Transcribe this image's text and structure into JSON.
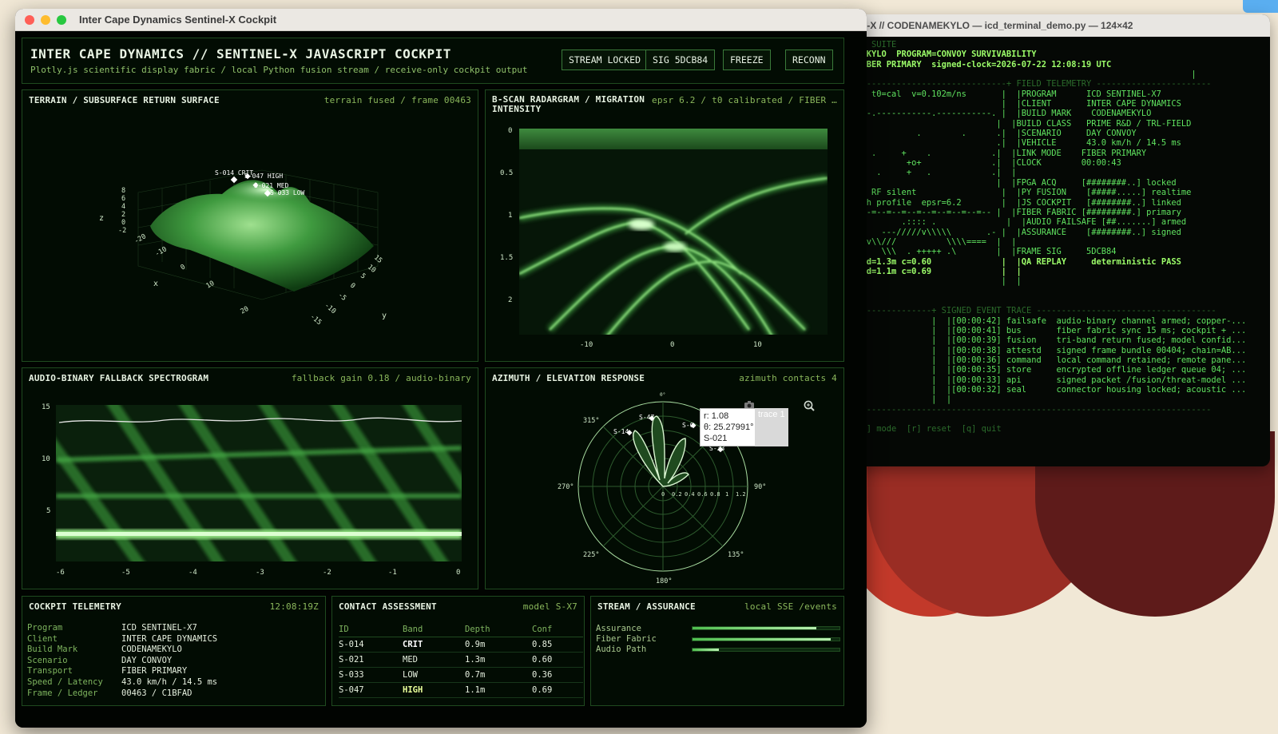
{
  "desktop": {
    "accent": "#5aaef0"
  },
  "terminal": {
    "title": "l-X // CODENAMEKYLO — icd_terminal_demo.py — 124×42",
    "lines": [
      {
        "text": "ION SUITE",
        "cls": "t-dim"
      },
      {
        "text": "AMEKYLO  PROGRAM=CONVOY SURVIVABILITY",
        "cls": "t-bright"
      },
      {
        "text": "=FIBER PRIMARY  signed-clock=2026-07-22 12:08:19 UTC",
        "cls": "t-bright"
      },
      {
        "text": "                                                                    |",
        "cls": ""
      },
      {
        "text": "-------------------------------+ FIELD TELEMETRY -----------------------",
        "cls": "t-dim"
      },
      {
        "text": "63  t0=cal  v=0.102m/ns       |  |PROGRAM      ICD SENTINEL-X7",
        "cls": ""
      },
      {
        "text": "                              |  |CLIENT       INTER CAPE DYNAMICS",
        "cls": ""
      },
      {
        "text": "----.-----------.-----------. |  |BUILD MARK    CODENAMEKYLO",
        "cls": ""
      },
      {
        "text": "                             |  |BUILD CLASS   PRIME R&D / TRL-FIELD",
        "cls": ""
      },
      {
        "text": "  .          .        .      .|  |SCENARIO     DAY CONVOY",
        "cls": ""
      },
      {
        "text": "+                            .|  |VEHICLE      43.0 km/h / 14.5 ms",
        "cls": ""
      },
      {
        "text": "x+  .     +    .            .|  |LINK MODE    FIBER PRIMARY",
        "cls": ""
      },
      {
        "text": "+          +o+              .|  |CLOCK        00:00:43",
        "cls": ""
      },
      {
        "text": "     .     +   .            .|  |",
        "cls": ""
      },
      {
        "text": "                             |  |FPGA ACQ     [########..] locked",
        "cls": ""
      },
      {
        "text": "B | RF silent                 |  |PY FUSION    [#####.....] realtime",
        "cls": ""
      },
      {
        "text": "epth profile  epsr=6.2        |  |JS COCKPIT   [########..] linked",
        "cls": ""
      },
      {
        "text": "-=--=--=--=--=--=--=--=--=-- |  |FIBER FABRIC [#########.] primary",
        "cls": ""
      },
      {
        "text": "          .:::: .              |  |AUDIO FAILSAFE [##.......] armed",
        "cls": ""
      },
      {
        "text": "      ---/////v\\\\\\\\\\       .- |  |ASSURANCE    [########..] signed",
        "cls": ""
      },
      {
        "text": "///v\\\\///          \\\\\\\\====  |  |",
        "cls": ""
      },
      {
        "text": "  /   \\\\\\  . +++++ .\\        |  |FRAME SIG     5DCB84",
        "cls": ""
      },
      {
        "text": "ED d=1.3m c=0.60              |  |QA REPLAY     deterministic PASS",
        "cls": "t-bright"
      },
      {
        "text": "GH d=1.1m c=0.69              |  |",
        "cls": "t-bright"
      },
      {
        "text": "                              |  |",
        "cls": ""
      },
      {
        "text": "",
        "cls": ""
      },
      {
        "text": "",
        "cls": ""
      },
      {
        "text": "----------------+ SIGNED EVENT TRACE ------------------------------------",
        "cls": "t-dim"
      },
      {
        "text": "                |  |[00:00:42] failsafe  audio-binary channel armed; copper-...",
        "cls": ""
      },
      {
        "text": "                |  |[00:00:41] bus       fiber fabric sync 15 ms; cockpit + ...",
        "cls": ""
      },
      {
        "text": "                |  |[00:00:39] fusion    tri-band return fused; model confid...",
        "cls": ""
      },
      {
        "text": "ore             |  |[00:00:38] attestd   signed frame bundle 00404; chain=AB...",
        "cls": ""
      },
      {
        "text": "ll              |  |[00:00:36] command   local command retained; remote pane...",
        "cls": ""
      },
      {
        "text": "                |  |[00:00:35] store     encrypted offline ledger queue 04; ...",
        "cls": ""
      },
      {
        "text": "and             |  |[00:00:33] api       signed packet /fusion/threat-model ...",
        "cls": ""
      },
      {
        "text": "                |  |[00:00:32] seal      connector housing locked; acoustic ...",
        "cls": ""
      },
      {
        "text": "                |  |",
        "cls": ""
      },
      {
        "text": "------------------------------------------------------------------------",
        "cls": "t-dim"
      },
      {
        "text": "",
        "cls": ""
      },
      {
        "text": " [m] mode  [r] reset  [q] quit",
        "cls": "t-dim"
      }
    ]
  },
  "window": {
    "title": "Inter Cape Dynamics Sentinel-X Cockpit"
  },
  "header": {
    "title": "INTER CAPE DYNAMICS // SENTINEL-X JAVASCRIPT COCKPIT",
    "subtitle": "Plotly.js scientific display fabric / local Python fusion stream / receive-only cockpit output",
    "buttons": {
      "stream": "STREAM LOCKED",
      "sig": "SIG 5DCB84",
      "freeze": "FREEZE",
      "reconn": "RECONN"
    }
  },
  "terrain": {
    "title": "TERRAIN / SUBSURFACE RETURN SURFACE",
    "meta": "terrain fused / frame 00463",
    "z_ticks": [
      "8",
      "6",
      "4",
      "2",
      "0",
      "-2"
    ],
    "x_ticks": [
      "-20",
      "-10",
      "0",
      "10",
      "20"
    ],
    "y_ticks": [
      "15",
      "10",
      "5",
      "0",
      "-5",
      "-10",
      "-15"
    ],
    "x_label": "x",
    "y_label": "y",
    "z_label": "z",
    "markers": [
      "S-014 CRIT",
      "S-047 HIGH",
      "S-021 MED",
      "S-033 LOW"
    ]
  },
  "bscan": {
    "title": "B-SCAN RADARGRAM / MIGRATION INTENSITY",
    "meta": "epsr 6.2 / t0 calibrated / FIBER …",
    "y_ticks": [
      "0",
      "0.5",
      "1",
      "1.5",
      "2"
    ],
    "x_ticks": [
      "-10",
      "0",
      "10"
    ]
  },
  "spectrogram": {
    "title": "AUDIO-BINARY FALLBACK SPECTROGRAM",
    "meta": "fallback gain 0.18 / audio-binary",
    "y_ticks": [
      "15",
      "10",
      "5"
    ],
    "x_ticks": [
      "-6",
      "-5",
      "-4",
      "-3",
      "-2",
      "-1",
      "0"
    ]
  },
  "polar": {
    "title": "AZIMUTH / ELEVATION RESPONSE",
    "meta": "azimuth contacts 4",
    "angle_labels": [
      "0°",
      "315°",
      "270°",
      "225°",
      "180°",
      "135°",
      "90°"
    ],
    "radial_ticks": [
      "0",
      "0.2",
      "0.4",
      "0.6",
      "0.8",
      "1",
      "1.2"
    ],
    "contacts": [
      "S-47",
      "S-14",
      "S-0",
      "S-33"
    ],
    "tooltip": {
      "r": "r: 1.08",
      "theta": "θ: 25.27991°",
      "name": "S-021"
    },
    "trace_tag": "trace 1"
  },
  "telemetry": {
    "title": "COCKPIT TELEMETRY",
    "time": "12:08:19Z",
    "rows": [
      {
        "k": "Program",
        "v": "ICD SENTINEL-X7"
      },
      {
        "k": "Client",
        "v": "INTER CAPE DYNAMICS"
      },
      {
        "k": "Build Mark",
        "v": "CODENAMEKYLO"
      },
      {
        "k": "Scenario",
        "v": "DAY CONVOY"
      },
      {
        "k": "Transport",
        "v": "FIBER PRIMARY"
      },
      {
        "k": "Speed / Latency",
        "v": "43.0 km/h / 14.5 ms"
      },
      {
        "k": "Frame / Ledger",
        "v": "00463 / C1BFAD"
      }
    ]
  },
  "contacts": {
    "title": "CONTACT ASSESSMENT",
    "meta": "model S-X7",
    "columns": [
      "ID",
      "Band",
      "Depth",
      "Conf"
    ],
    "rows": [
      {
        "id": "S-014",
        "band": "CRIT",
        "depth": "0.9m",
        "conf": "0.85"
      },
      {
        "id": "S-021",
        "band": "MED",
        "depth": "1.3m",
        "conf": "0.60"
      },
      {
        "id": "S-033",
        "band": "LOW",
        "depth": "0.7m",
        "conf": "0.36"
      },
      {
        "id": "S-047",
        "band": "HIGH",
        "depth": "1.1m",
        "conf": "0.69"
      }
    ]
  },
  "stream": {
    "title": "STREAM / ASSURANCE",
    "meta": "local SSE /events",
    "bars": [
      {
        "label": "Assurance",
        "value": 0.84
      },
      {
        "label": "Fiber Fabric",
        "value": 0.94
      },
      {
        "label": "Audio Path",
        "value": 0.18
      }
    ]
  }
}
